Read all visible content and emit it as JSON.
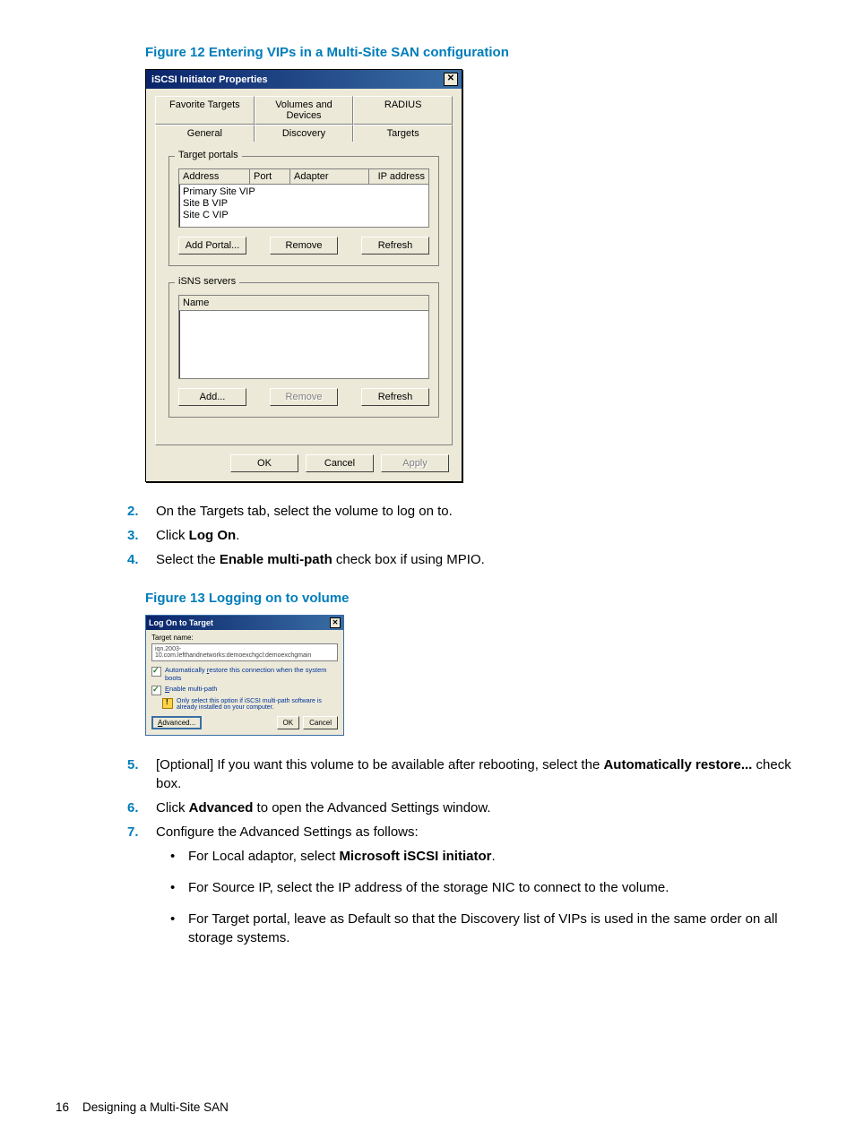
{
  "captions": {
    "fig12": "Figure 12 Entering VIPs in a Multi-Site SAN configuration",
    "fig13": "Figure 13 Logging on to volume"
  },
  "dlg12": {
    "title": "iSCSI Initiator Properties",
    "tabs_back": [
      "Favorite Targets",
      "Volumes and Devices",
      "RADIUS"
    ],
    "tabs_front": [
      "General",
      "Discovery",
      "Targets"
    ],
    "group1": {
      "legend": "Target portals",
      "headers": {
        "c1": "Address",
        "c2": "Port",
        "c3": "Adapter",
        "c4": "IP address"
      },
      "rows": [
        "Primary Site VIP",
        "Site B VIP",
        "Site C VIP"
      ],
      "buttons": {
        "add": "Add Portal...",
        "remove": "Remove",
        "refresh": "Refresh"
      }
    },
    "group2": {
      "legend": "iSNS servers",
      "header": "Name",
      "buttons": {
        "add": "Add...",
        "remove": "Remove",
        "refresh": "Refresh"
      }
    },
    "bottom": {
      "ok": "OK",
      "cancel": "Cancel",
      "apply": "Apply"
    }
  },
  "stepsA": {
    "s2_a": "On the Targets tab, select the volume to log on to.",
    "s3_a": "Click ",
    "s3_b": "Log On",
    "s3_c": ".",
    "s4_a": "Select the ",
    "s4_b": "Enable multi-path",
    "s4_c": " check box if using MPIO."
  },
  "dlg13": {
    "title": "Log On to Target",
    "targetLabel": "Target name:",
    "targetValue": "iqn.2003-10.com.lefthandnetworks:demoexchgcl:demoexchgmain",
    "check1_a": "Automatically ",
    "check1_u": "r",
    "check1_b": "estore this connection when the system boots",
    "check2_u": "E",
    "check2_a": "nable multi-path",
    "warn": "Only select this option if iSCSI multi-path software is already installed on your computer.",
    "buttons": {
      "adv_u": "A",
      "adv": "dvanced...",
      "ok": "OK",
      "cancel": "Cancel"
    }
  },
  "stepsB": {
    "s5_a": "[Optional] If you want this volume to be available after rebooting, select the ",
    "s5_b": "Automatically restore...",
    "s5_c": " check box.",
    "s6_a": "Click ",
    "s6_b": "Advanced",
    "s6_c": " to open the Advanced Settings window.",
    "s7_a": "Configure the Advanced Settings as follows:"
  },
  "bullets": {
    "b1_a": "For Local adaptor, select ",
    "b1_b": "Microsoft iSCSI initiator",
    "b1_c": ".",
    "b2": "For Source IP, select the IP address of the storage NIC to connect to the volume.",
    "b3": "For Target portal, leave as Default so that the Discovery list of VIPs is used in the same order on all storage systems."
  },
  "footer": {
    "page": "16",
    "text": "Designing a Multi-Site SAN"
  }
}
